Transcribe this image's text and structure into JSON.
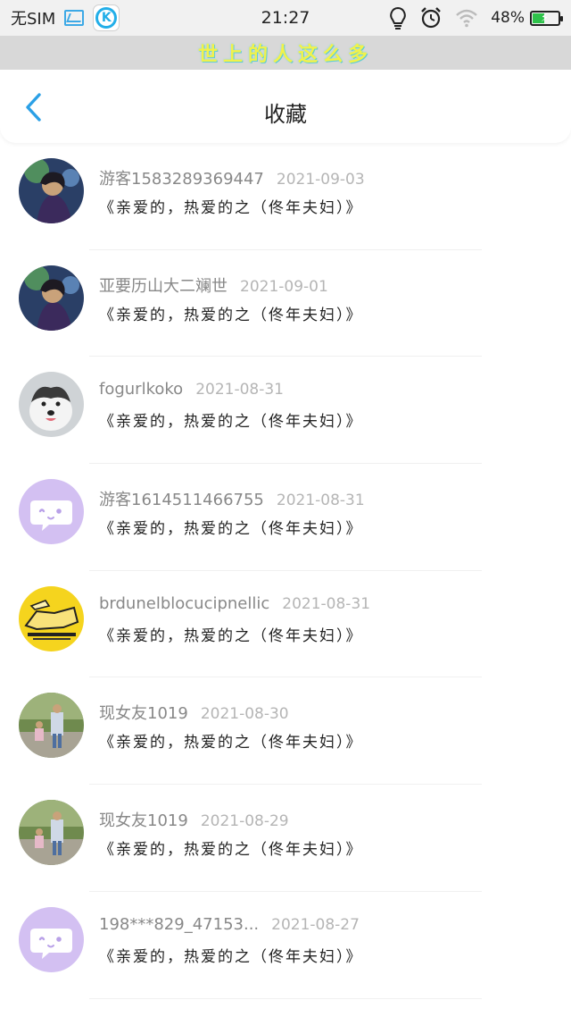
{
  "status_bar": {
    "carrier": "无SIM",
    "time": "21:27",
    "battery_percent": "48%",
    "battery_level": 0.48,
    "icons": [
      "gallery-icon",
      "k-app-icon",
      "bulb-icon",
      "alarm-icon",
      "wifi-icon",
      "battery-icon"
    ]
  },
  "banner": {
    "text": "世上的人这么多"
  },
  "header": {
    "title": "收藏",
    "back_icon": "chevron-left-icon"
  },
  "colors": {
    "accent": "#2ba0e6",
    "name_gray": "#888888",
    "date_gray": "#b5b5b5",
    "avatar_purple": "#d3c0f2",
    "avatar_yellow": "#f5d41e"
  },
  "favorites": [
    {
      "username": "游客1583289369447",
      "date": "2021-09-03",
      "content": "《亲爱的，热爱的之（佟年夫妇）》",
      "avatar": "photo-anime-man"
    },
    {
      "username": "亚要历山大二斓世",
      "date": "2021-09-01",
      "content": "《亲爱的，热爱的之（佟年夫妇）》",
      "avatar": "photo-anime-man"
    },
    {
      "username": "fogurlkoko",
      "date": "2021-08-31",
      "content": "《亲爱的，热爱的之（佟年夫妇）》",
      "avatar": "photo-husky-puppy"
    },
    {
      "username": "游客1614511466755",
      "date": "2021-08-31",
      "content": "《亲爱的，热爱的之（佟年夫妇）》",
      "avatar": "default-chat-avatar"
    },
    {
      "username": "brdunelblocucipnellic",
      "date": "2021-08-31",
      "content": "《亲爱的，热爱的之（佟年夫妇）》",
      "avatar": "yellow-illustration"
    },
    {
      "username": "现女友1019",
      "date": "2021-08-30",
      "content": "《亲爱的，热爱的之（佟年夫妇）》",
      "avatar": "photo-people-outdoor"
    },
    {
      "username": "现女友1019",
      "date": "2021-08-29",
      "content": "《亲爱的，热爱的之（佟年夫妇）》",
      "avatar": "photo-people-outdoor"
    },
    {
      "username": "198***829_47153...",
      "date": "2021-08-27",
      "content": "《亲爱的，热爱的之（佟年夫妇）》",
      "avatar": "default-chat-avatar"
    }
  ]
}
